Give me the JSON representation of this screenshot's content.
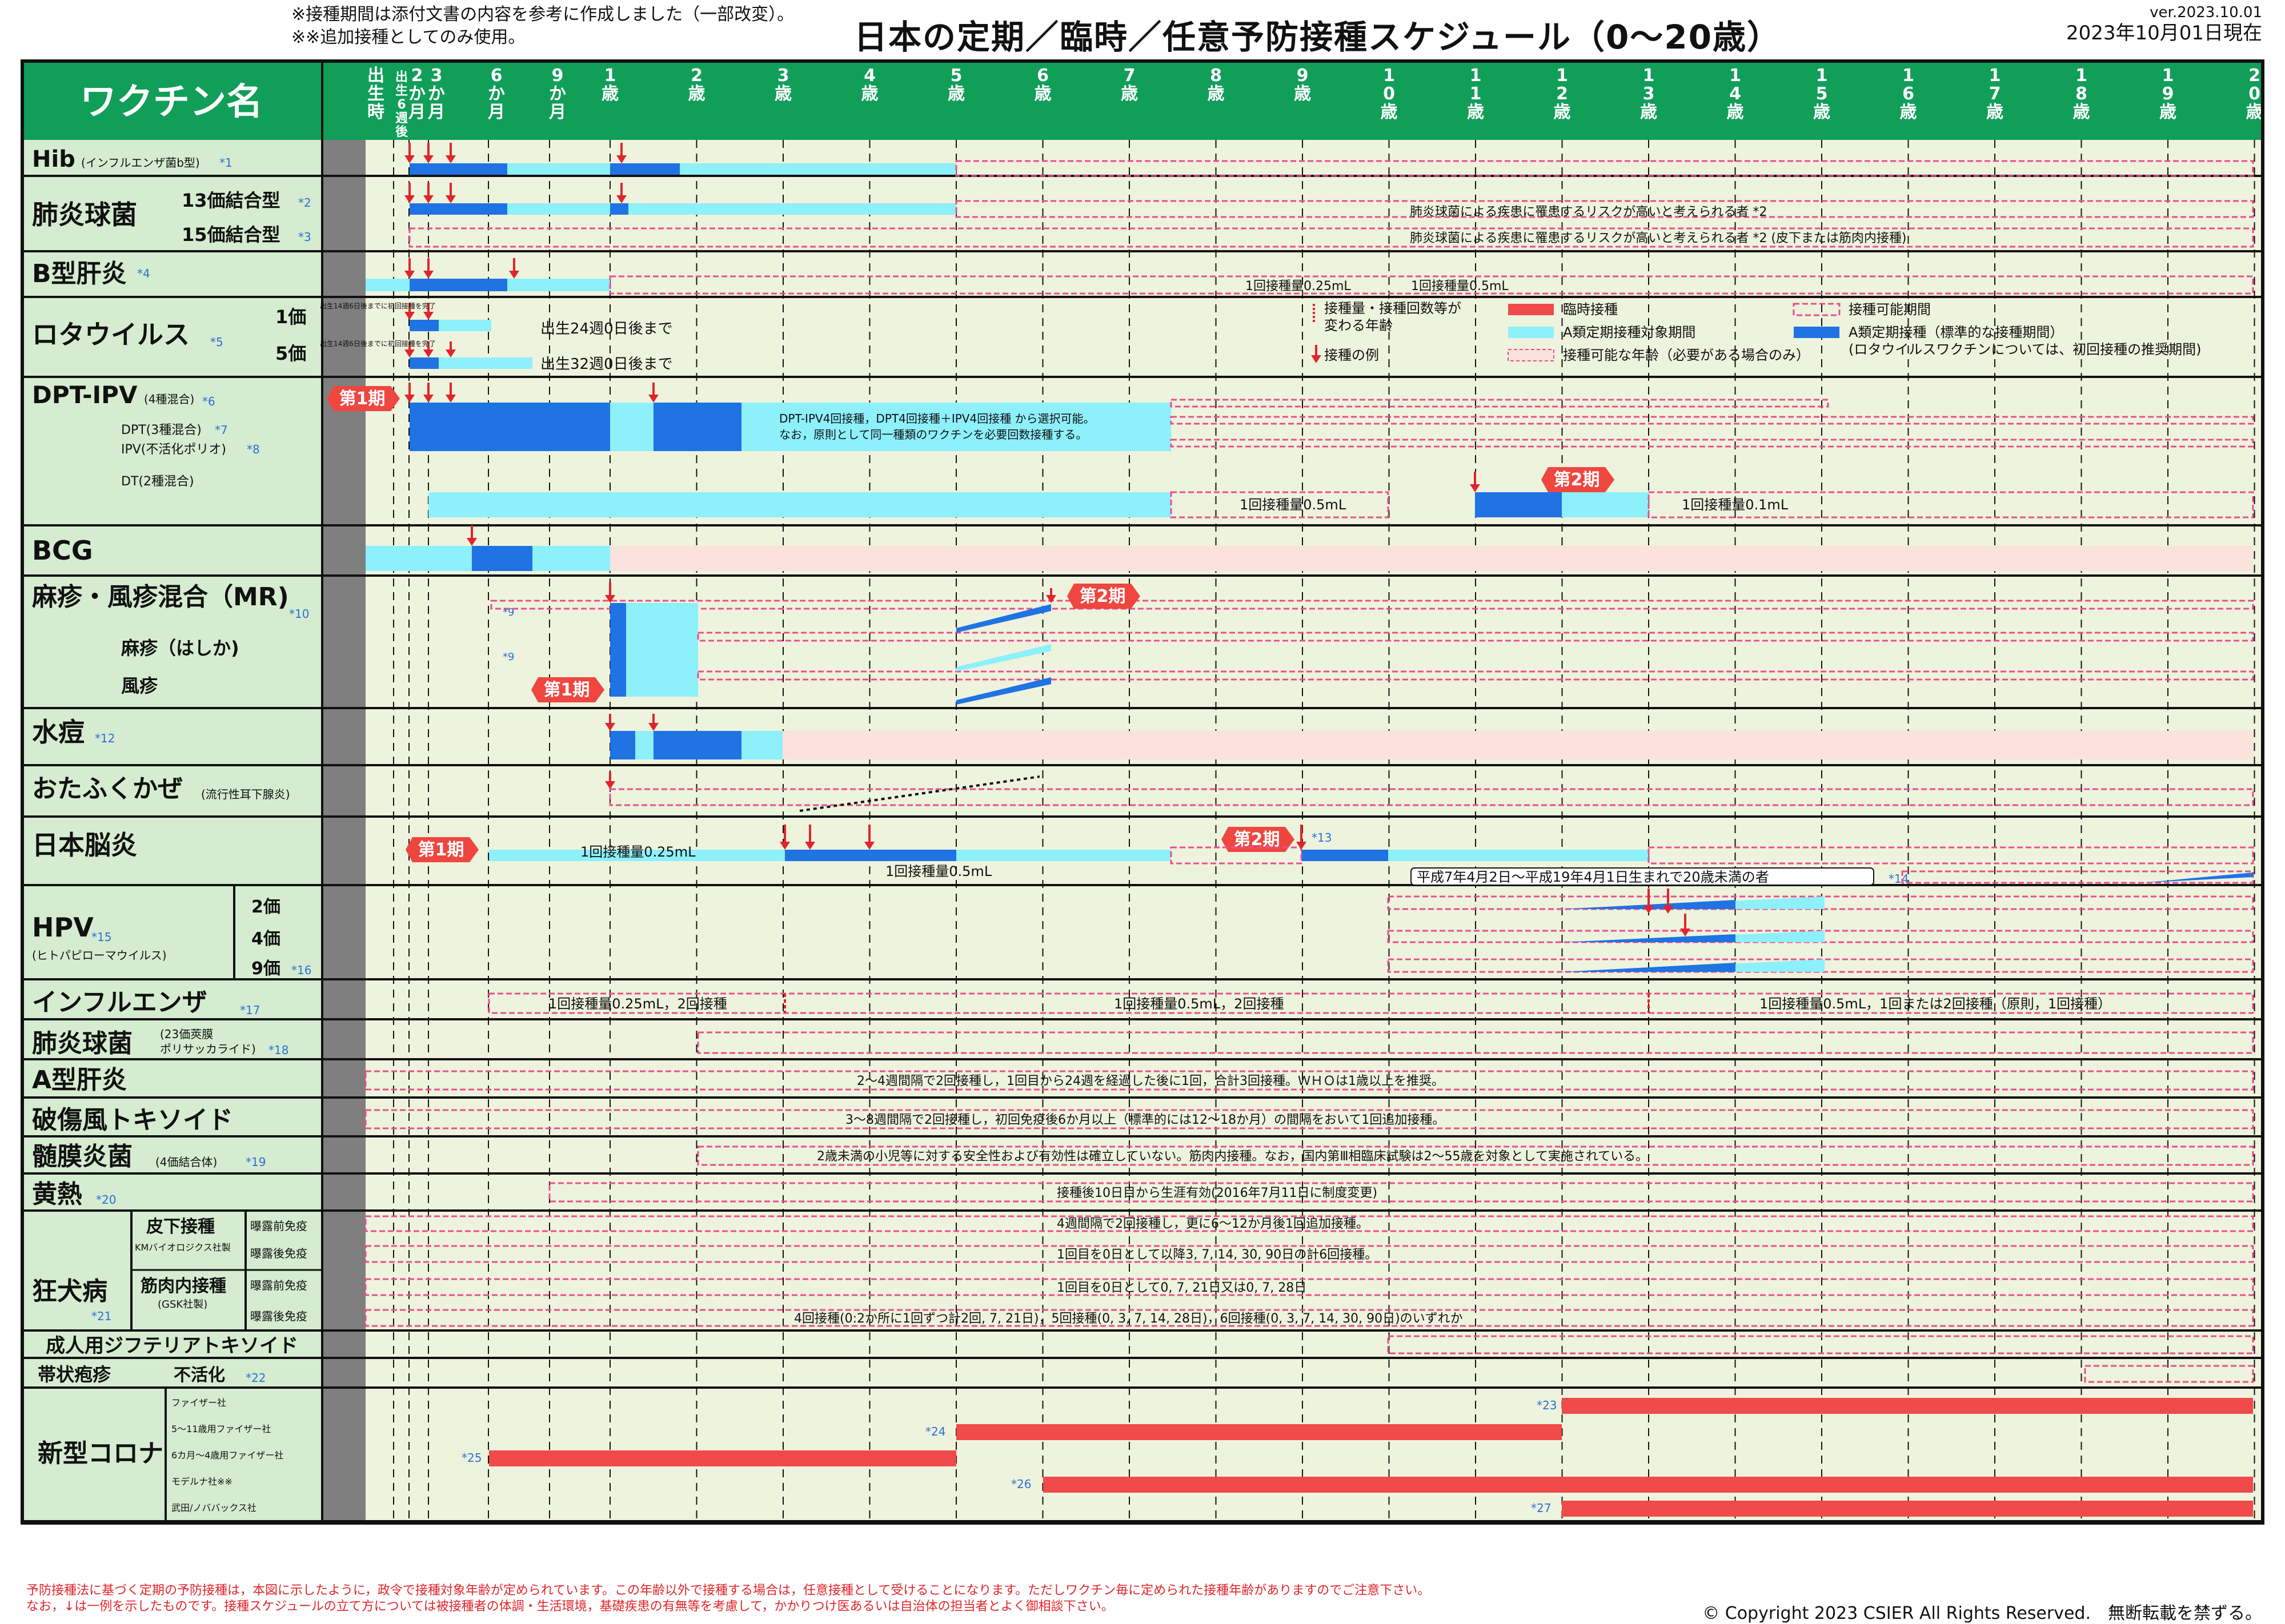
{
  "notes": [
    "※接種期間は添付文書の内容を参考に作成しました（一部改変）。",
    "※※追加接種としてのみ使用。"
  ],
  "title": "日本の定期／臨時／任意予防接種スケジュール（0〜20歳）",
  "version": "ver.2023.10.01",
  "date": "2023年10月01日現在",
  "colors": {
    "header_green": "#119e59",
    "label_green": "#d5ecd0",
    "body_bg": "#eef3dd",
    "vertical_lane": "#f9e4dc",
    "blue": "#1f73e3",
    "light_blue": "#8df0fb",
    "red": "#f04a4a",
    "pink": "#e94e8c"
  },
  "chart_data": {
    "type": "table",
    "header_label": "ワクチン名",
    "age_columns": [
      "出生時",
      "出生6週後",
      "2か月",
      "3か月",
      "6か月",
      "9か月",
      "1歳",
      "2歳",
      "3歳",
      "4歳",
      "5歳",
      "6歳",
      "7歳",
      "8歳",
      "9歳",
      "10歳",
      "11歳",
      "12歳",
      "13歳",
      "14歳",
      "15歳",
      "16歳",
      "17歳",
      "18歳",
      "19歳",
      "20歳"
    ],
    "legend": [
      {
        "key": "age_change",
        "label": "接種量・接種回数等が変わる年齢",
        "icon": "red-dashed-vertical-icon"
      },
      {
        "key": "temporary",
        "label": "臨時接種",
        "icon": "red-bar-icon"
      },
      {
        "key": "possible",
        "label": "接種可能期間",
        "icon": "pink-dashed-box-icon"
      },
      {
        "key": "a_target",
        "label": "A類定期接種対象期間",
        "icon": "light-blue-bar-icon"
      },
      {
        "key": "a_standard",
        "label": "A類定期接種（標準的な接種期間）",
        "icon": "blue-bar-icon"
      },
      {
        "key": "a_standard_note",
        "label": "(ロタウイルスワクチンについては、初回接種の推奨期間)"
      },
      {
        "key": "example",
        "label": "接種の例",
        "icon": "red-arrow-icon"
      },
      {
        "key": "possible_age",
        "label": "接種可能な年齢（必要がある場合のみ）",
        "icon": "pink-shaded-box-icon"
      }
    ],
    "rows": [
      {
        "name": "Hib",
        "sub": "（インフルエンザ菌b型）",
        "note": "*1"
      },
      {
        "name": "肺炎球菌",
        "variants": [
          "13価結合型 *2",
          "15価結合型 *3"
        ]
      },
      {
        "name": "B型肝炎",
        "note": "*4"
      },
      {
        "name": "ロタウイルス",
        "note": "*5",
        "variants": [
          "1価",
          "5価"
        ]
      },
      {
        "name": "DPT-IPV",
        "sub": "(4種混合)",
        "note": "*6",
        "variants": [
          "DPT(3種混合) *7",
          "IPV(不活化ポリオ) *8",
          "DT(2種混合)"
        ]
      },
      {
        "name": "BCG"
      },
      {
        "name": "麻疹・風疹混合（MR)",
        "note": "*10",
        "variants": [
          "麻疹（はしか)",
          "風疹"
        ]
      },
      {
        "name": "水痘",
        "note": "*12"
      },
      {
        "name": "おたふくかぜ",
        "sub": "(流行性耳下腺炎)"
      },
      {
        "name": "日本脳炎"
      },
      {
        "name": "HPV",
        "note": "*15",
        "sub": "(ヒトパピローマウイルス)",
        "variants": [
          "2価",
          "4価",
          "9価 *16"
        ]
      },
      {
        "name": "インフルエンザ",
        "note": "*17"
      },
      {
        "name": "肺炎球菌",
        "sub": "(23価莢膜ポリサッカライド)",
        "note": "*18"
      },
      {
        "name": "A型肝炎"
      },
      {
        "name": "破傷風トキソイド"
      },
      {
        "name": "髄膜炎菌",
        "sub": "(4価結合体)",
        "note": "*19"
      },
      {
        "name": "黄熱",
        "note": "*20"
      },
      {
        "name": "狂犬病",
        "note": "*21",
        "variants": [
          "皮下接種",
          "KMバイオロジクス社製",
          "筋肉内接種",
          "(GSK社製)",
          "曝露前免疫",
          "曝露後免疫"
        ]
      },
      {
        "name": "成人用ジフテリアトキソイド"
      },
      {
        "name": "帯状疱疹",
        "variants": [
          "不活化 *22"
        ]
      },
      {
        "name": "新型コロナ",
        "variants": [
          "ファイザー社",
          "5〜11歳用ファイザー社",
          "6カ月〜4歳用ファイザー社",
          "モデルナ社※※",
          "武田/ノババックス社"
        ]
      }
    ],
    "annotations": [
      "肺炎球菌による疾患に罹患するリスクが高いと考えられる者 *2",
      "肺炎球菌による疾患に罹患するリスクが高いと考えられる者 *2 (皮下または筋肉内接種)",
      "1回接種量0.25mL",
      "1回接種量0.5mL",
      "出生14週6日後までに初回接種を完了",
      "出生24週0日後まで",
      "出生32週0日後まで",
      "第1期",
      "第2期",
      "DPT-IPV4回接種，DPT4回接種＋IPV4回接種 から選択可能。",
      "なお，原則として同一種類のワクチンを必要回数接種する。",
      "1回接種量0.1mL",
      "*9",
      "*13",
      "*14",
      "平成7年4月2日〜平成19年4月1日生まれで20歳未満の者",
      "1回接種量0.25mL，2回接種",
      "1回接種量0.5mL，2回接種",
      "1回接種量0.5mL，1回または2回接種（原則，1回接種）",
      "2〜4週間隔で2回接種し，1回目から24週を経過した後に1回，合計3回接種。ＷＨＯは1歳以上を推奨。",
      "3〜8週間隔で2回接種し，初回免疫後6か月以上（標準的には12〜18か月）の間隔をおいて1回追加接種。",
      "2歳未満の小児等に対する安全性および有効性は確立していない。筋肉内接種。なお，国内第Ⅲ相臨床試験は2〜55歳を対象として実施されている。",
      "接種後10日目から生涯有効(2016年7月11日に制度変更)",
      "4週間隔で2回接種し，更に6〜12か月後1回追加接種。",
      "1回目を0日として以降3, 7, 14, 30, 90日の計6回接種。",
      "1回目を0日として0, 7, 21日又は0, 7, 28日",
      "4回接種(0:2か所に1回ずつ計2回, 7, 21日)，5回接種(0, 3, 7, 14, 28日)，6回接種(0, 3, 7, 14, 30, 90日)のいずれか",
      "*23",
      "*24",
      "*25",
      "*26",
      "*27"
    ]
  },
  "footer": [
    "予防接種法に基づく定期の予防接種は，本図に示したように，政令で接種対象年齢が定められています。この年齢以外で接種する場合は，任意接種として受けることになります。ただしワクチン毎に定められた接種年齢がありますのでご注意下さい。",
    "なお，↓は一例を示したものです。接種スケジュールの立て方については被接種者の体調・生活環境，基礎疾患の有無等を考慮して，かかりつけ医あるいは自治体の担当者とよく御相談下さい。"
  ],
  "copyright": "© Copyright 2023 CSIER All Rights Reserved.　無断転載を禁ずる。"
}
